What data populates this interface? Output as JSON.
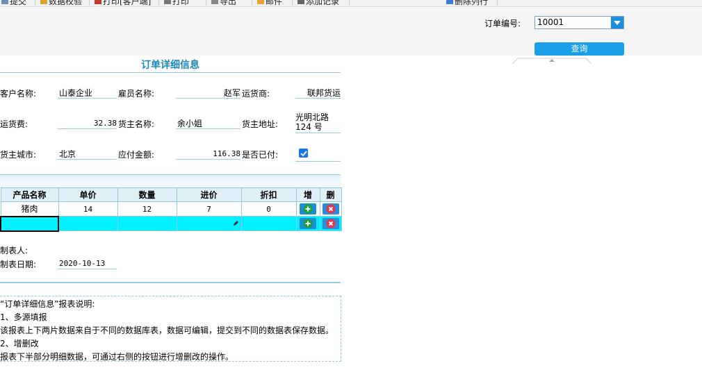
{
  "toolbar": {
    "items": [
      {
        "label": "提交",
        "icon": "submit-icon"
      },
      {
        "label": "数据校验",
        "icon": "verify-icon"
      },
      {
        "label": "打印[客户端]",
        "icon": "pdf-print-icon"
      },
      {
        "label": "打印",
        "icon": "printer-icon"
      },
      {
        "label": "导出",
        "icon": "export-icon"
      },
      {
        "label": "邮件",
        "icon": "mail-icon"
      },
      {
        "label": "添加记录",
        "icon": "add-record-icon"
      },
      {
        "label": "删除列行",
        "icon": "delete-row-icon"
      }
    ]
  },
  "params": {
    "order_label": "订单编号:",
    "order_value": "10001",
    "query_label": "查询"
  },
  "report": {
    "title": "订单详细信息",
    "fields": {
      "customer_label": "客户名称:",
      "customer_value": "山泰企业",
      "employee_label": "雇员名称:",
      "employee_value": "赵军",
      "shipper_label": "运货商:",
      "shipper_value": "联邦货运",
      "freight_label": "运货费:",
      "freight_value": "32.38",
      "owner_label": "货主名称:",
      "owner_value": "余小姐",
      "address_label": "货主地址:",
      "address_value_line1": "光明北路",
      "address_value_line2": "124 号",
      "city_label": "货主城市:",
      "city_value": "北京",
      "amount_label": "应付金额:",
      "amount_value": "116.38",
      "paid_label": "是否已付:",
      "paid_checked": true
    },
    "table": {
      "headers": [
        "产品名称",
        "单价",
        "数量",
        "进价",
        "折扣",
        "增",
        "删"
      ],
      "rows": [
        {
          "product": "猪肉",
          "price": "14",
          "qty": "12",
          "cost": "7",
          "discount": "0"
        }
      ]
    },
    "footer": {
      "maker_label": "制表人:",
      "date_label": "制表日期:",
      "date_value": "2020-10-13"
    },
    "notes": [
      "“订单详细信息”报表说明:",
      "1、多源填报",
      "该报表上下两片数据来自于不同的数据库表，数据可编辑，提交到不同的数据表保存数据。",
      "2、增删改",
      "报表下半部分明细数据，可通过右侧的按钮进行增删改的操作。"
    ]
  },
  "colors": {
    "accent": "#1a9fe6",
    "title": "#1d88b8",
    "edit_row": "#00f0ff",
    "delete_icon": "#e8314a",
    "add_icon": "#1f9f3a"
  }
}
